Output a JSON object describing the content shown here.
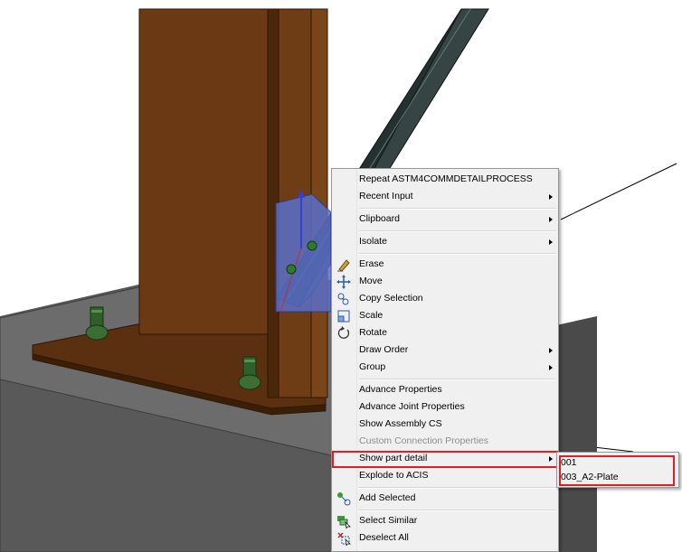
{
  "viewport": {
    "colors": {
      "column": "#6b3a14",
      "column_dark": "#4a2709",
      "base_plate": "#5c3210",
      "pedestal_top": "#6a6a6a",
      "pedestal_side": "#4a4a4a",
      "brace": "#2a3536",
      "bolt": "#2f5f2a",
      "gusset": "#5a6fc8"
    }
  },
  "context_menu": {
    "items": [
      {
        "label": "Repeat ASTM4COMMDETAILPROCESS",
        "icon": "",
        "submenu": false
      },
      {
        "label": "Recent Input",
        "icon": "",
        "submenu": true
      },
      {
        "separator": true
      },
      {
        "label": "Clipboard",
        "icon": "",
        "submenu": true
      },
      {
        "separator": true
      },
      {
        "label": "Isolate",
        "icon": "",
        "submenu": true
      },
      {
        "separator": true
      },
      {
        "label": "Erase",
        "icon": "eraser-icon",
        "submenu": false
      },
      {
        "label": "Move",
        "icon": "move-icon",
        "submenu": false
      },
      {
        "label": "Copy Selection",
        "icon": "copy-selection-icon",
        "submenu": false
      },
      {
        "label": "Scale",
        "icon": "scale-icon",
        "submenu": false
      },
      {
        "label": "Rotate",
        "icon": "rotate-icon",
        "submenu": false
      },
      {
        "label": "Draw Order",
        "icon": "",
        "submenu": true
      },
      {
        "label": "Group",
        "icon": "",
        "submenu": true
      },
      {
        "separator": true
      },
      {
        "label": "Advance Properties",
        "icon": "",
        "submenu": false
      },
      {
        "label": "Advance Joint Properties",
        "icon": "",
        "submenu": false
      },
      {
        "label": "Show Assembly CS",
        "icon": "",
        "submenu": false
      },
      {
        "label": "Custom Connection Properties",
        "icon": "",
        "submenu": false,
        "disabled": true
      },
      {
        "label": "Show part detail",
        "icon": "",
        "submenu": true,
        "highlighted": true
      },
      {
        "label": "Explode to ACIS",
        "icon": "",
        "submenu": false
      },
      {
        "separator": true
      },
      {
        "label": "Add Selected",
        "icon": "add-selected-icon",
        "submenu": false
      },
      {
        "separator": true
      },
      {
        "label": "Select Similar",
        "icon": "select-similar-icon",
        "submenu": false
      },
      {
        "label": "Deselect All",
        "icon": "deselect-all-icon",
        "submenu": false
      }
    ]
  },
  "submenu": {
    "items": [
      "001",
      "003_A2-Plate"
    ],
    "highlight_color": "#e01e25"
  }
}
